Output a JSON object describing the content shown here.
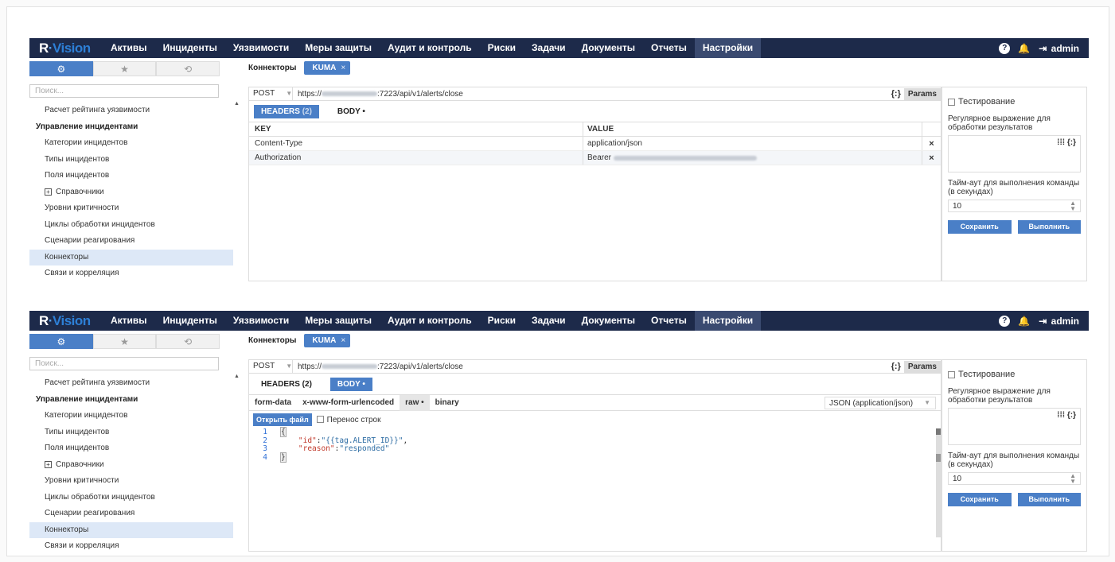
{
  "logo": {
    "r": "R",
    "dot": "·",
    "v": "Vision"
  },
  "nav": [
    "Активы",
    "Инциденты",
    "Уязвимости",
    "Меры защиты",
    "Аудит и контроль",
    "Риски",
    "Задачи",
    "Документы",
    "Отчеты",
    "Настройки"
  ],
  "user": "admin",
  "icons": {
    "settings": "⚙",
    "favorites": "★",
    "history": "⟲",
    "help": "?",
    "bell": "🔔",
    "logout": "⇥"
  },
  "tabs": {
    "connectors": "Коннекторы",
    "kuma": "KUMA",
    "close": "×"
  },
  "sidebar": {
    "search_placeholder": "Поиск...",
    "items": [
      "Расчет рейтинга уязвимости",
      "Управление инцидентами",
      "Категории инцидентов",
      "Типы инцидентов",
      "Поля инцидентов",
      "Справочники",
      "Уровни критичности",
      "Циклы обработки инцидентов",
      "Сценарии реагирования",
      "Коннекторы",
      "Связи и корреляция"
    ]
  },
  "request": {
    "method": "POST",
    "url_prefix": "https://",
    "url_suffix": ":7223/api/v1/alerts/close",
    "braces": "{:}",
    "params": "Params"
  },
  "panel1": {
    "tab_headers": "HEADERS",
    "headers_count": "(2)",
    "tab_body": "BODY •",
    "col_key": "KEY",
    "col_value": "VALUE",
    "rows": [
      {
        "key": "Content-Type",
        "value": "application/json"
      },
      {
        "key": "Authorization",
        "value": "Bearer"
      }
    ],
    "delete": "×"
  },
  "panel2": {
    "tab_headers": "HEADERS (2)",
    "tab_body": "BODY •",
    "body_types": [
      "form-data",
      "x-www-form-urlencoded",
      "raw •",
      "binary"
    ],
    "content_type": "JSON (application/json)",
    "open_file": "Открыть файл",
    "wrap": "Перенос строк",
    "code": {
      "line_numbers": [
        "1",
        "2",
        "3",
        "4"
      ],
      "l1": "{",
      "l2_key": "\"id\"",
      "l2_sep": ":",
      "l2_val": "\"{{tag.ALERT_ID}}\"",
      "l2_end": ",",
      "l3_key": "\"reason\"",
      "l3_sep": ":",
      "l3_val": "\"responded\"",
      "l4": "}"
    }
  },
  "right": {
    "testing": "Тестирование",
    "regex_label": "Регулярное выражение для обработки результатов",
    "regex_icon": "⁞⁞⁞ {:}",
    "timeout_label": "Тайм-аут для выполнения команды (в секундах)",
    "timeout_value": "10",
    "save": "Сохранить",
    "run": "Выполнить"
  }
}
